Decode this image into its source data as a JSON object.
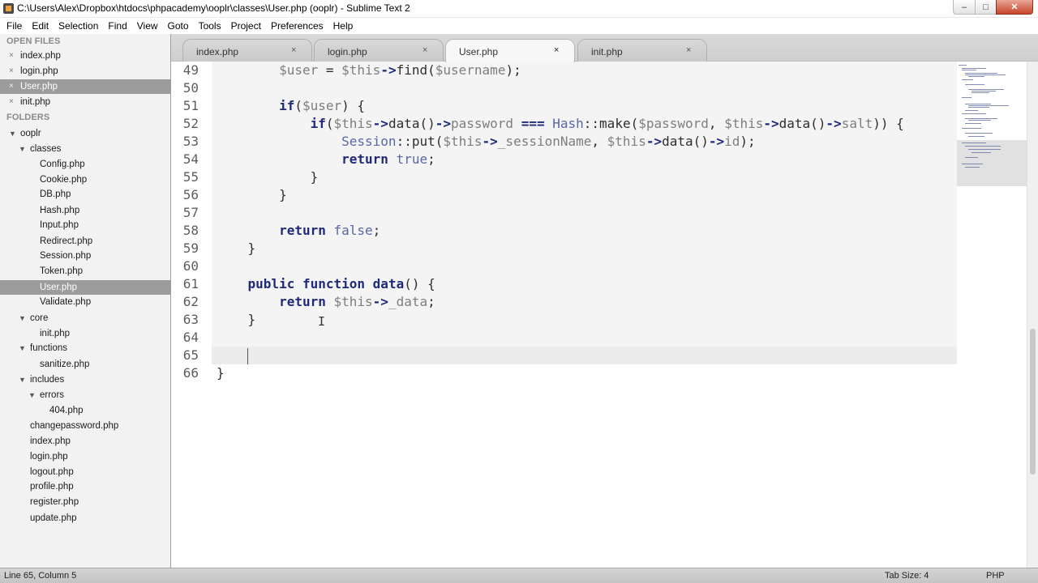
{
  "window": {
    "title": "C:\\Users\\Alex\\Dropbox\\htdocs\\phpacademy\\ooplr\\classes\\User.php (ooplr) - Sublime Text 2",
    "minimize_label": "–",
    "maximize_label": "□",
    "close_label": "✕"
  },
  "menu": [
    "File",
    "Edit",
    "Selection",
    "Find",
    "View",
    "Goto",
    "Tools",
    "Project",
    "Preferences",
    "Help"
  ],
  "sidebar": {
    "open_files_header": "OPEN FILES",
    "open_files": [
      {
        "label": "index.php",
        "close": "×",
        "selected": false
      },
      {
        "label": "login.php",
        "close": "×",
        "selected": false
      },
      {
        "label": "User.php",
        "close": "×",
        "selected": true
      },
      {
        "label": "init.php",
        "close": "×",
        "selected": false
      }
    ],
    "folders_header": "FOLDERS",
    "tree": [
      {
        "label": "ooplr",
        "depth": 0,
        "folder": true
      },
      {
        "label": "classes",
        "depth": 1,
        "folder": true
      },
      {
        "label": "Config.php",
        "depth": 2
      },
      {
        "label": "Cookie.php",
        "depth": 2
      },
      {
        "label": "DB.php",
        "depth": 2
      },
      {
        "label": "Hash.php",
        "depth": 2
      },
      {
        "label": "Input.php",
        "depth": 2
      },
      {
        "label": "Redirect.php",
        "depth": 2
      },
      {
        "label": "Session.php",
        "depth": 2
      },
      {
        "label": "Token.php",
        "depth": 2
      },
      {
        "label": "User.php",
        "depth": 2,
        "selected": true
      },
      {
        "label": "Validate.php",
        "depth": 2
      },
      {
        "label": "core",
        "depth": 1,
        "folder": true
      },
      {
        "label": "init.php",
        "depth": 2
      },
      {
        "label": "functions",
        "depth": 1,
        "folder": true
      },
      {
        "label": "sanitize.php",
        "depth": 2
      },
      {
        "label": "includes",
        "depth": 1,
        "folder": true
      },
      {
        "label": "errors",
        "depth": 2,
        "folder": true
      },
      {
        "label": "404.php",
        "depth": 3
      },
      {
        "label": "changepassword.php",
        "depth": 1
      },
      {
        "label": "index.php",
        "depth": 1
      },
      {
        "label": "login.php",
        "depth": 1
      },
      {
        "label": "logout.php",
        "depth": 1
      },
      {
        "label": "profile.php",
        "depth": 1
      },
      {
        "label": "register.php",
        "depth": 1
      },
      {
        "label": "update.php",
        "depth": 1
      }
    ],
    "folder_expanded_icon": "▼"
  },
  "tabs": [
    {
      "label": "index.php",
      "close": "×",
      "active": false
    },
    {
      "label": "login.php",
      "close": "×",
      "active": false
    },
    {
      "label": "User.php",
      "close": "×",
      "active": true
    },
    {
      "label": "init.php",
      "close": "×",
      "active": false
    }
  ],
  "editor": {
    "current_line": 65,
    "lines": [
      {
        "n": "49",
        "tokens": [
          [
            "",
            "        "
          ],
          [
            "tk-var",
            "$user"
          ],
          [
            "tk-punc",
            " = "
          ],
          [
            "tk-var",
            "$this"
          ],
          [
            "tk-arrow",
            "->"
          ],
          [
            "tk-meth",
            "find("
          ],
          [
            "tk-var",
            "$username"
          ],
          [
            "tk-punc",
            ");"
          ]
        ]
      },
      {
        "n": "50",
        "tokens": []
      },
      {
        "n": "51",
        "tokens": [
          [
            "",
            "        "
          ],
          [
            "tk-kw",
            "if"
          ],
          [
            "tk-punc",
            "("
          ],
          [
            "tk-var",
            "$user"
          ],
          [
            "tk-punc",
            ") {"
          ]
        ]
      },
      {
        "n": "52",
        "tokens": [
          [
            "",
            "            "
          ],
          [
            "tk-kw",
            "if"
          ],
          [
            "tk-punc",
            "("
          ],
          [
            "tk-var",
            "$this"
          ],
          [
            "tk-arrow",
            "->"
          ],
          [
            "tk-meth",
            "data()"
          ],
          [
            "tk-arrow",
            "->"
          ],
          [
            "tk-prop",
            "password"
          ],
          [
            "tk-punc",
            " "
          ],
          [
            "tk-op",
            "==="
          ],
          [
            "tk-punc",
            " "
          ],
          [
            "tk-cls",
            "Hash"
          ],
          [
            "tk-punc",
            "::make("
          ],
          [
            "tk-var",
            "$password"
          ],
          [
            "tk-punc",
            ", "
          ],
          [
            "tk-var",
            "$this"
          ],
          [
            "tk-arrow",
            "->"
          ],
          [
            "tk-meth",
            "data()"
          ],
          [
            "tk-arrow",
            "->"
          ],
          [
            "tk-prop",
            "salt"
          ],
          [
            "tk-punc",
            ")) {"
          ]
        ]
      },
      {
        "n": "53",
        "tokens": [
          [
            "",
            "                "
          ],
          [
            "tk-cls",
            "Session"
          ],
          [
            "tk-punc",
            "::put("
          ],
          [
            "tk-var",
            "$this"
          ],
          [
            "tk-arrow",
            "->"
          ],
          [
            "tk-prop",
            "_sessionName"
          ],
          [
            "tk-punc",
            ", "
          ],
          [
            "tk-var",
            "$this"
          ],
          [
            "tk-arrow",
            "->"
          ],
          [
            "tk-meth",
            "data()"
          ],
          [
            "tk-arrow",
            "->"
          ],
          [
            "tk-prop",
            "id"
          ],
          [
            "tk-punc",
            ");"
          ]
        ]
      },
      {
        "n": "54",
        "tokens": [
          [
            "",
            "                "
          ],
          [
            "tk-kw",
            "return"
          ],
          [
            "tk-punc",
            " "
          ],
          [
            "tk-bool",
            "true"
          ],
          [
            "tk-punc",
            ";"
          ]
        ]
      },
      {
        "n": "55",
        "tokens": [
          [
            "",
            "            "
          ],
          [
            "tk-punc",
            "}"
          ]
        ]
      },
      {
        "n": "56",
        "tokens": [
          [
            "",
            "        "
          ],
          [
            "tk-punc",
            "}"
          ]
        ]
      },
      {
        "n": "57",
        "tokens": []
      },
      {
        "n": "58",
        "tokens": [
          [
            "",
            "        "
          ],
          [
            "tk-kw",
            "return"
          ],
          [
            "tk-punc",
            " "
          ],
          [
            "tk-bool",
            "false"
          ],
          [
            "tk-punc",
            ";"
          ]
        ]
      },
      {
        "n": "59",
        "tokens": [
          [
            "",
            "    "
          ],
          [
            "tk-punc",
            "}"
          ]
        ]
      },
      {
        "n": "60",
        "tokens": []
      },
      {
        "n": "61",
        "tokens": [
          [
            "",
            "    "
          ],
          [
            "tk-kw",
            "public"
          ],
          [
            "tk-punc",
            " "
          ],
          [
            "tk-kw",
            "function"
          ],
          [
            "tk-punc",
            " "
          ],
          [
            "tk-kw",
            "data"
          ],
          [
            "tk-punc",
            "() {"
          ]
        ]
      },
      {
        "n": "62",
        "tokens": [
          [
            "",
            "        "
          ],
          [
            "tk-kw",
            "return"
          ],
          [
            "tk-punc",
            " "
          ],
          [
            "tk-var",
            "$this"
          ],
          [
            "tk-arrow",
            "->"
          ],
          [
            "tk-prop",
            "_data"
          ],
          [
            "tk-punc",
            ";"
          ]
        ]
      },
      {
        "n": "63",
        "tokens": [
          [
            "",
            "    "
          ],
          [
            "tk-punc",
            "}"
          ]
        ]
      },
      {
        "n": "64",
        "tokens": []
      },
      {
        "n": "65",
        "tokens": []
      },
      {
        "n": "66",
        "tokens": [
          [
            "tk-punc",
            "}"
          ]
        ]
      }
    ]
  },
  "status": {
    "position": "Line 65, Column 5",
    "tab_size": "Tab Size: 4",
    "syntax": "PHP"
  },
  "colors": {
    "selected_row": "#9c9c9c",
    "keyword": "#1f2a7a",
    "variable": "#7e7e7e",
    "class": "#5867a6"
  },
  "icons": {
    "app": "sublime-text-icon",
    "caret": "text-cursor-ibeam-icon"
  }
}
